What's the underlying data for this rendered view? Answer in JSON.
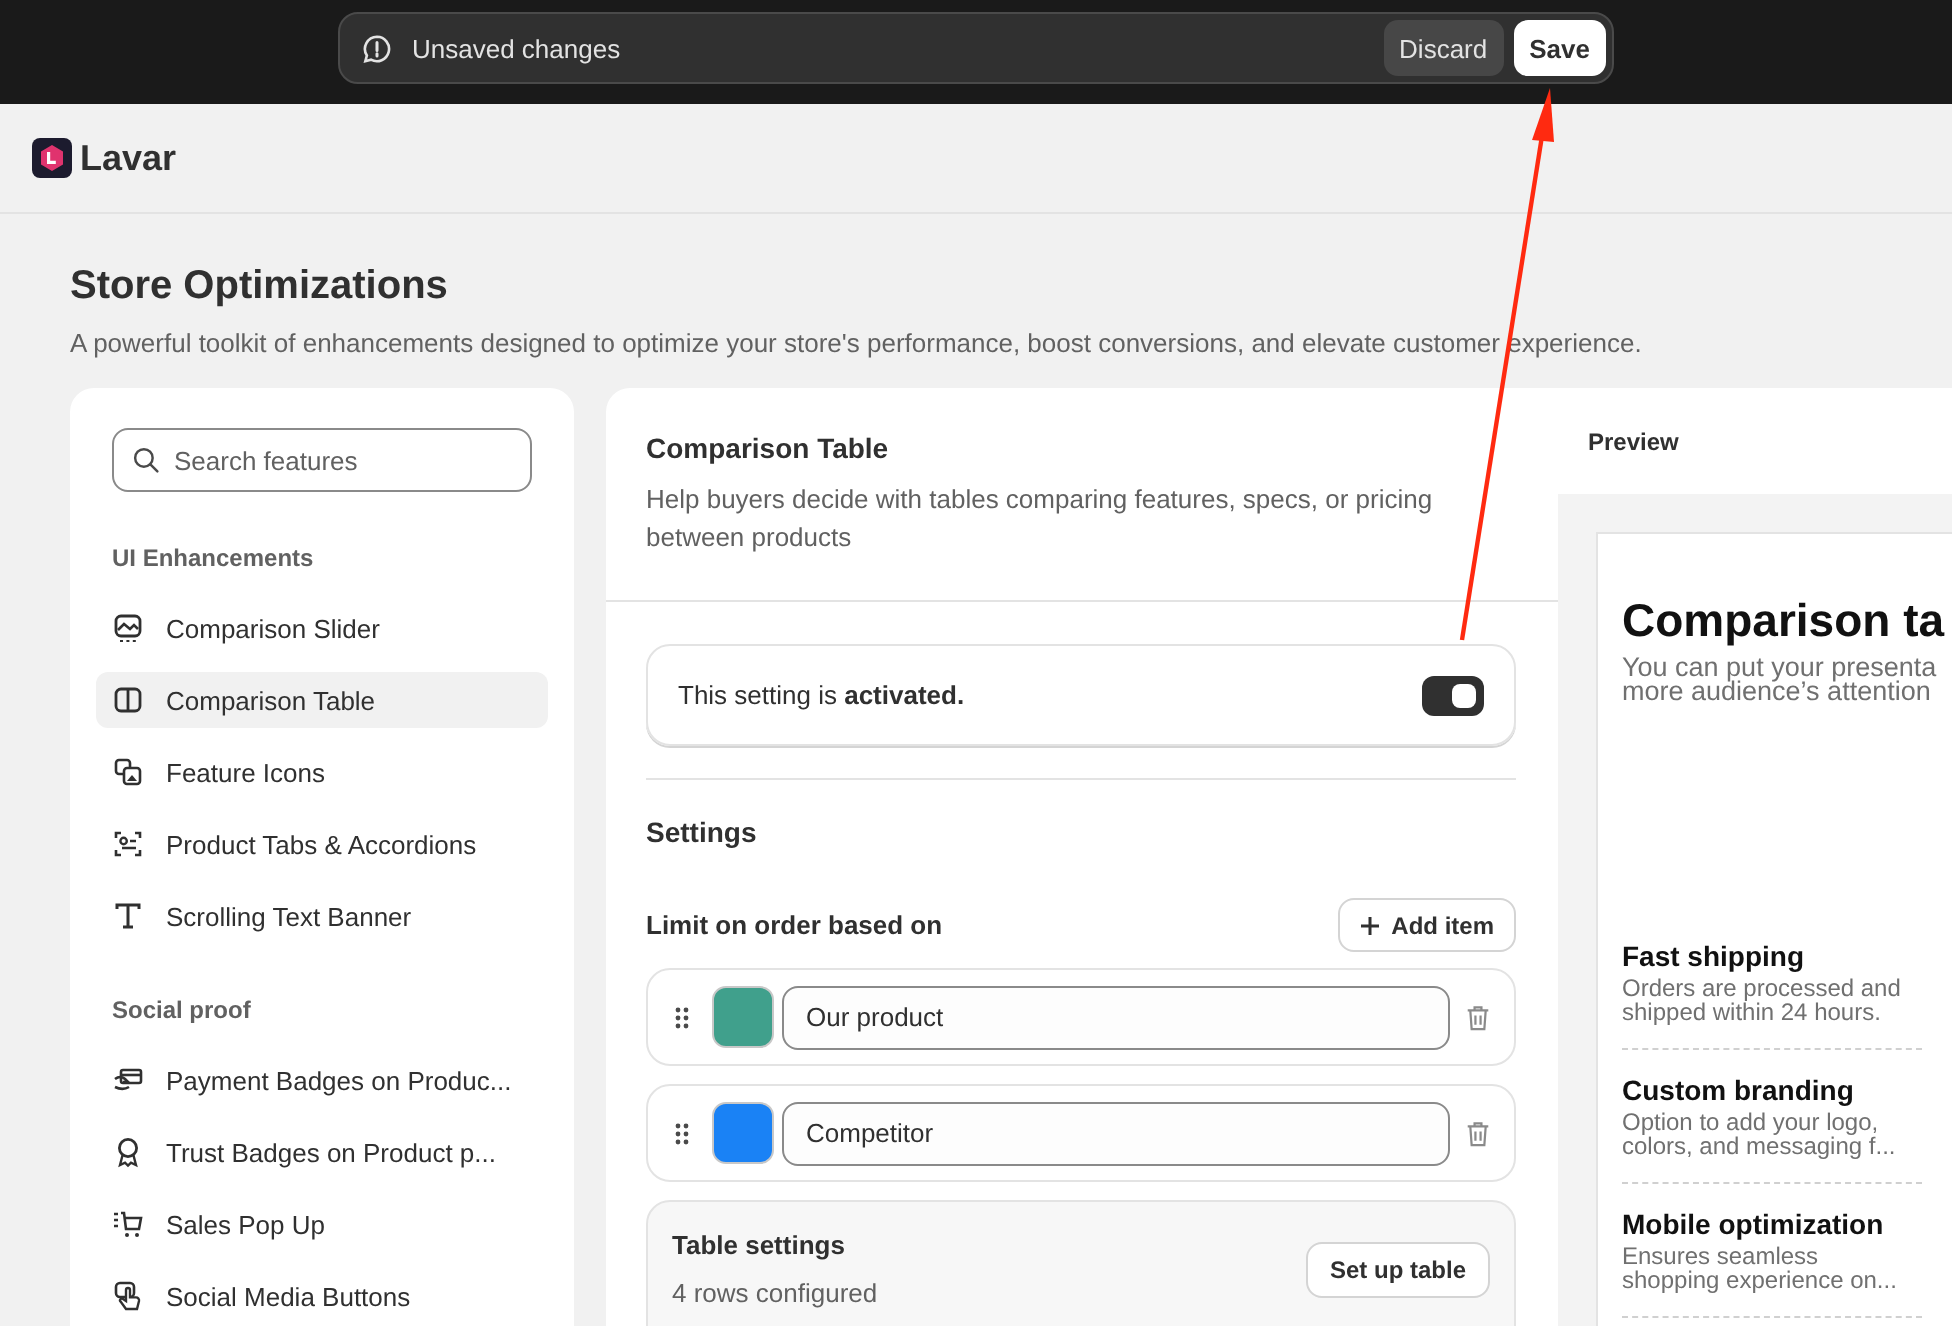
{
  "save_bar": {
    "message": "Unsaved changes",
    "buttons": [
      {
        "label": "Discard",
        "kind": "secondary"
      },
      {
        "label": "Save",
        "kind": "primary"
      }
    ]
  },
  "app": {
    "name": "Lavar"
  },
  "page": {
    "title": "Store Optimizations",
    "subtitle": "A powerful toolkit of enhancements designed to optimize your store's performance, boost conversions, and elevate customer experience."
  },
  "sidebar": {
    "search": {
      "placeholder": "Search features"
    },
    "sections": [
      {
        "heading": "UI Enhancements",
        "items": [
          {
            "label": "Comparison Slider",
            "kind": "slider",
            "selected": false
          },
          {
            "label": "Comparison Table",
            "kind": "table",
            "selected": true
          },
          {
            "label": "Feature Icons",
            "kind": "images",
            "selected": false
          },
          {
            "label": "Product Tabs & Accordions",
            "kind": "tabs",
            "selected": false
          },
          {
            "label": "Scrolling Text Banner",
            "kind": "text",
            "selected": false
          }
        ]
      },
      {
        "heading": "Social proof",
        "items": [
          {
            "label": "Payment Badges on Produc...",
            "kind": "payment",
            "selected": false
          },
          {
            "label": "Trust Badges on Product p...",
            "kind": "badge",
            "selected": false
          },
          {
            "label": "Sales Pop Up",
            "kind": "cart",
            "selected": false
          },
          {
            "label": "Social Media Buttons",
            "kind": "hand",
            "selected": false
          }
        ]
      }
    ]
  },
  "feature": {
    "title": "Comparison Table",
    "description": "Help buyers decide with tables comparing features, specs, or pricing between products",
    "activation": {
      "text": "This setting is **activated.**",
      "on": true
    },
    "settings_heading": "Settings",
    "limit": {
      "label": "Limit on order based on",
      "add_button": "Add item",
      "items": [
        {
          "value": "Our product",
          "color": "#40a08c"
        },
        {
          "value": "Competitor",
          "color": "#1a82f5"
        }
      ]
    },
    "table_settings": {
      "title": "Table settings",
      "status": "4 rows configured",
      "button": "Set up table"
    }
  },
  "preview": {
    "tab": "Preview",
    "title": "Comparison ta",
    "description": [
      "You can put your presenta",
      "more audience’s attention"
    ],
    "features": [
      {
        "title": "Fast shipping",
        "description": "Orders are processed and shipped within 24 hours."
      },
      {
        "title": "Custom branding",
        "description": "Option to add your logo, colors, and messaging f..."
      },
      {
        "title": "Mobile optimization",
        "description": "Ensures seamless shopping experience on..."
      }
    ]
  }
}
